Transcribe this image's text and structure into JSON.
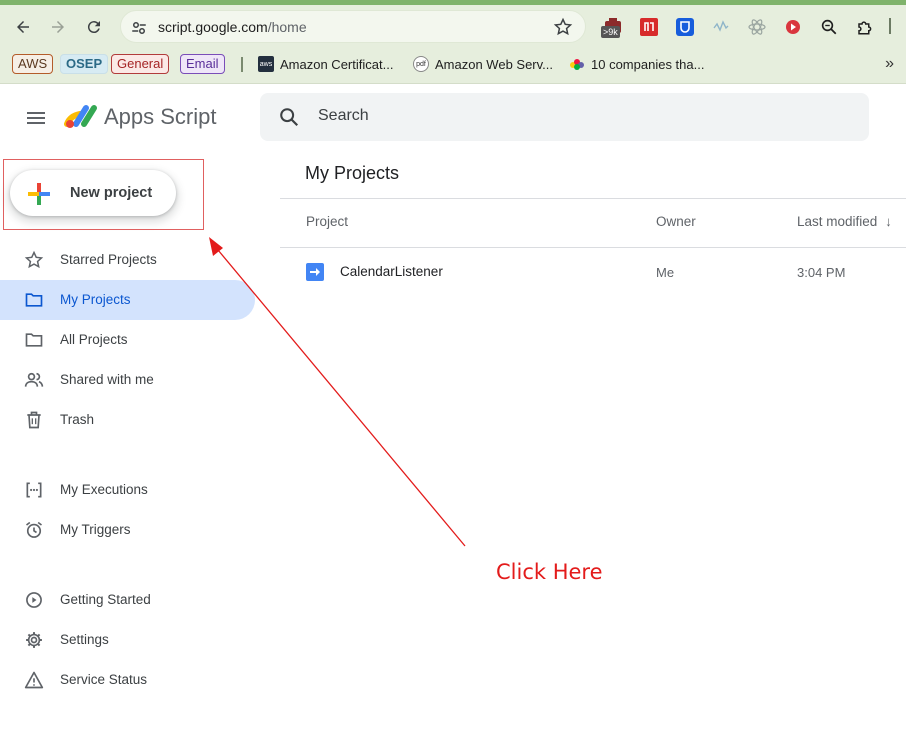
{
  "browser": {
    "url_host": "script.google.com",
    "url_path": "/home",
    "extension_badge": ">9k",
    "bookmark_chips": [
      "AWS",
      "OSEP",
      "General",
      "Email"
    ],
    "bookmarks": [
      "Amazon Certificat...",
      "Amazon Web Serv...",
      "10 companies tha..."
    ],
    "more_glyph": "»"
  },
  "header": {
    "app_title": "Apps Script",
    "search_placeholder": "Search"
  },
  "new_project_label": "New project",
  "sidebar": {
    "items": [
      {
        "label": "Starred Projects",
        "icon": "star-icon"
      },
      {
        "label": "My Projects",
        "icon": "folder-icon",
        "active": true
      },
      {
        "label": "All Projects",
        "icon": "folder-icon"
      },
      {
        "label": "Shared with me",
        "icon": "people-icon"
      },
      {
        "label": "Trash",
        "icon": "trash-icon"
      },
      {
        "label": "My Executions",
        "icon": "executions-icon"
      },
      {
        "label": "My Triggers",
        "icon": "alarm-icon"
      },
      {
        "label": "Getting Started",
        "icon": "play-circle-icon"
      },
      {
        "label": "Settings",
        "icon": "gear-icon"
      },
      {
        "label": "Service Status",
        "icon": "warning-icon"
      }
    ]
  },
  "main": {
    "title": "My Projects",
    "columns": [
      "Project",
      "Owner",
      "Last modified"
    ],
    "sort_glyph": "↓",
    "rows": [
      {
        "name": "CalendarListener",
        "owner": "Me",
        "modified": "3:04 PM"
      }
    ]
  },
  "annotation": {
    "text": "Click Here",
    "color": "#e31b1b"
  },
  "colors": {
    "accent": "#0b57d0",
    "active_bg": "#d3e3fd",
    "chrome_bg": "#e6eedd"
  }
}
